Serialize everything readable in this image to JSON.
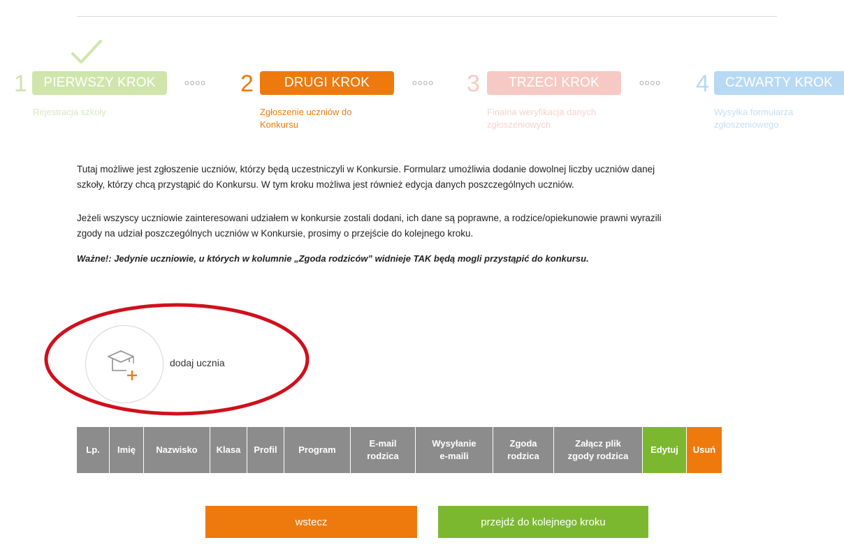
{
  "colors": {
    "step1": "#cfe5ab",
    "step2": "#ee7a0e",
    "step3": "#f7c9c4",
    "step4": "#b7d9f3",
    "annotation": "#d0101b",
    "table_header": "#8c8c8c",
    "edit": "#7cb82f",
    "delete": "#ee7a0e"
  },
  "icons": {
    "completed": "check-icon",
    "add_student": "graduation-cap-plus-icon"
  },
  "steps": [
    {
      "number": "1",
      "label": "PIERWSZY KROK",
      "desc": [
        "Rejestracja szkoły"
      ]
    },
    {
      "number": "2",
      "label": "DRUGI KROK",
      "desc": [
        "Zgłoszenie uczniów do",
        "Konkursu"
      ]
    },
    {
      "number": "3",
      "label": "TRZECI KROK",
      "desc": [
        "Finalna weryfikacja danych",
        "zgłoszeniowych"
      ]
    },
    {
      "number": "4",
      "label": "CZWARTY KROK",
      "desc": [
        "Wysyłka formularza",
        "zgłoszeniowego"
      ]
    }
  ],
  "separator": "oooo",
  "intro": {
    "p1_l1": "Tutaj możliwe jest zgłoszenie uczniów, którzy będą uczestniczyli w Konkursie. Formularz umożliwia dodanie dowolnej liczby uczniów danej",
    "p1_l2": "szkoły, którzy chcą przystąpić do Konkursu. W tym kroku możliwa jest również edycja danych poszczególnych uczniów.",
    "p2_l1": "Jeżeli wszyscy uczniowie zainteresowani udziałem w konkursie zostali dodani, ich dane są poprawne, a rodzice/opiekunowie prawni wyrazili",
    "p2_l2": "zgody na udział poszczególnych uczniów w Konkursie, prosimy o przejście do kolejnego kroku.",
    "note": "Ważne!: Jedynie uczniowie, u których w kolumnie „Zgoda rodziców” widnieje TAK będą mogli przystąpić do konkursu."
  },
  "add_student": {
    "label": "dodaj ucznia"
  },
  "table": {
    "columns": [
      [
        "Lp."
      ],
      [
        "Imię"
      ],
      [
        "Nazwisko"
      ],
      [
        "Klasa"
      ],
      [
        "Profil"
      ],
      [
        "Program"
      ],
      [
        "E-mail",
        "rodzica"
      ],
      [
        "Wysyłanie",
        "e-maili"
      ],
      [
        "Zgoda",
        "rodzica"
      ],
      [
        "Załącz plik",
        "zgody rodzica"
      ],
      [
        "Edytuj"
      ],
      [
        "Usuń"
      ]
    ]
  },
  "buttons": {
    "back": "wstecz",
    "next": "przejdź do kolejnego kroku"
  }
}
